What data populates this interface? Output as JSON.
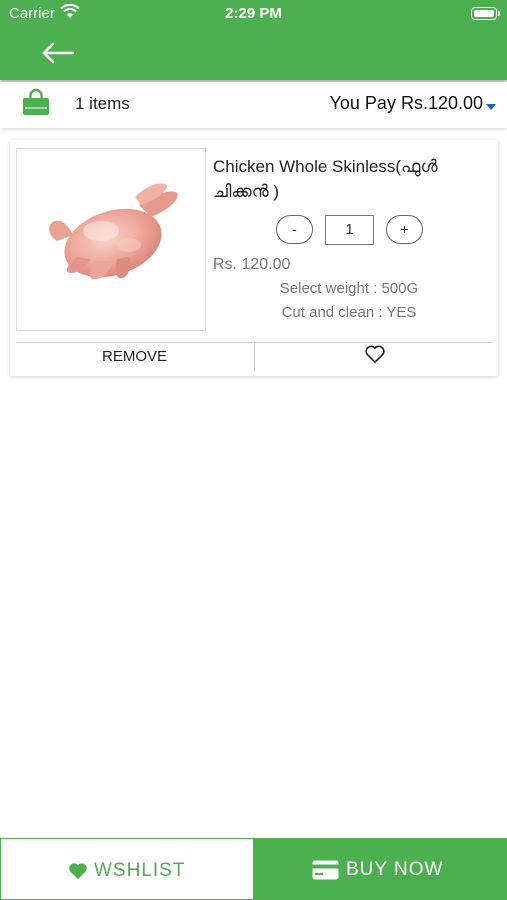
{
  "status_bar": {
    "carrier": "Carrier",
    "time": "2:29 PM"
  },
  "colors": {
    "primary": "#4caf50",
    "caret": "#1565c0"
  },
  "icons": {
    "back": "arrow-left-icon",
    "bag": "shopping-bag-icon",
    "caret": "caret-down-icon",
    "wishlist": "heart-icon",
    "buy": "credit-card-icon"
  },
  "summary": {
    "items_text": "1 items",
    "total_text": "You Pay Rs.120.00"
  },
  "cart": {
    "items": [
      {
        "name": "Chicken Whole Skinless(ഫുൾ ചിക്കൻ )",
        "quantity": "1",
        "minus_label": "-",
        "plus_label": "+",
        "price": "Rs. 120.00",
        "weight": "Select weight : 500G",
        "cut": "Cut and clean : YES",
        "remove_label": "REMOVE"
      }
    ]
  },
  "bottom": {
    "wishlist_label": "WSHLIST",
    "buy_label": "BUY NOW"
  }
}
